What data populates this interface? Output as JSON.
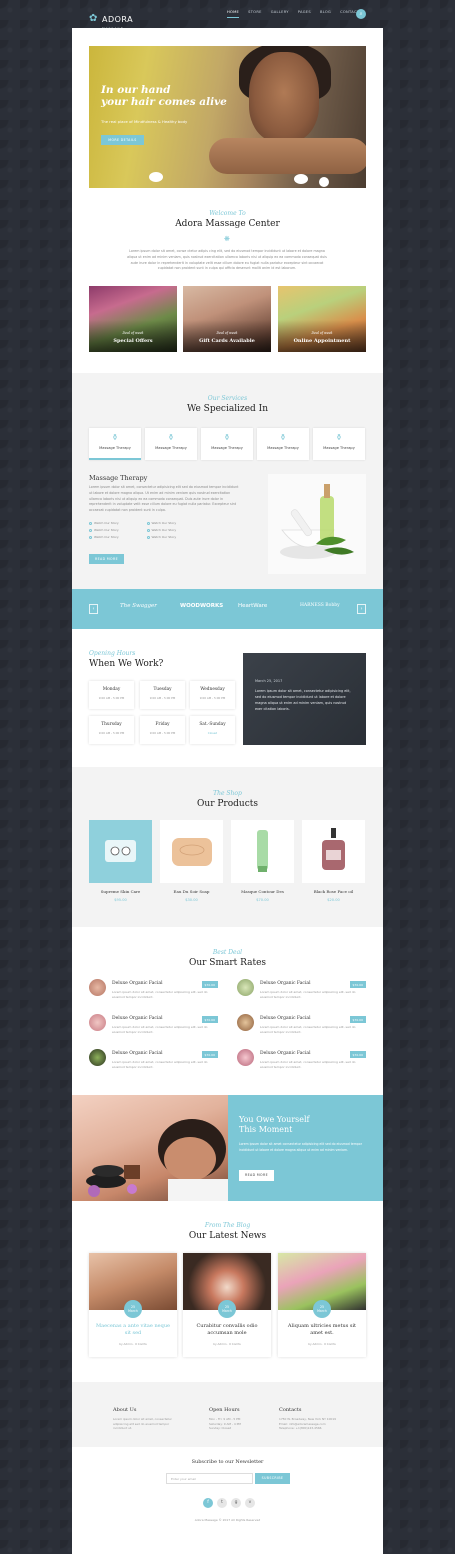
{
  "header": {
    "logo": "ADORA",
    "logo_sub": "MASSAGE",
    "nav": [
      "HOME",
      "STORE",
      "GALLERY",
      "PAGES",
      "BLOG",
      "CONTACT"
    ],
    "active_nav": "HOME"
  },
  "hero": {
    "title_line1": "In our hand",
    "title_line2": "your hair comes alive",
    "subtitle": "The real place of Mindfulness & Healthy body",
    "button": "MORE DETAILS"
  },
  "welcome": {
    "pre_title": "Welcome To",
    "title": "Adora Massage Center",
    "text": "Lorem ipsum dolor sit amet, conse ctetur adipis cing elit, sed do eiusmod tempor incididunt ut labore et dolore magna aliqua ut enim ad minim veniam, quis nostrud exercitation ullamco laboris nisi ut aliquip ex ea commodo consequat duis aute irure dolor in reprehenderit in voluptate velit esse cillum dolore eu fugiat nulla pariatur excepteur sint occaecat cupidatat non proident sunt in culpa qui officia deserunt mollit anim id est laborum."
  },
  "promos": [
    {
      "small": "Deal of week",
      "big": "Special Offers"
    },
    {
      "small": "Deal of week",
      "big": "Gift Cards Available"
    },
    {
      "small": "Deal of week",
      "big": "Online Appointment"
    }
  ],
  "services": {
    "pre_title": "Our Services",
    "title": "We Specialized In",
    "tabs": [
      "Massage Therapy",
      "Massage Therapy",
      "Massage Therapy",
      "Massage Therapy",
      "Massage Therapy"
    ],
    "detail_title": "Massage Therapy",
    "detail_text": "Lorem ipsum dolor sit amet, consectetur adipisicing elit sed do eiusmod tempor incididunt ut labore et dolore magna aliqua. Ut enim ad minim veniam quis nostrud exercitation ullamco laboris nisi ut aliquip ex ea commodo consequat. Duis aute irure dolor in reprehenderit in voluptate velit esse cillum dolore eu fugiat nulla pariatur. Excepteur sint occaecat cupidatat non proident sunt in culpa.",
    "list": [
      "Watch Our Story",
      "Watch Our Story",
      "Watch Our Story",
      "Watch Our Story",
      "Watch Our Story",
      "Watch Our Story"
    ],
    "button": "READ MORE"
  },
  "clients": [
    "The Swagger",
    "WOODWORKS",
    "HeartWare",
    "HARNESS Bobby"
  ],
  "hours": {
    "pre_title": "Opening Hours",
    "title": "When We Work?",
    "days": [
      {
        "name": "Monday",
        "hours": "9:00 AM - 5:00 PM"
      },
      {
        "name": "Tuesday",
        "hours": "9:00 AM - 5:00 PM"
      },
      {
        "name": "Wednesday",
        "hours": "9:00 AM - 5:00 PM"
      },
      {
        "name": "Thursday",
        "hours": "9:00 AM - 5:00 PM"
      },
      {
        "name": "Friday",
        "hours": "9:00 AM - 5:00 PM"
      },
      {
        "name": "Sat.-Sunday",
        "hours": "Closed"
      }
    ],
    "panel_date": "March 25, 2017",
    "panel_text": "Lorem ipsum dolor sit amet, consectetur adipisicing elit, sed do eiusmod tempor incididunt ut labore et dolore magna aliqua ut enim ad minim veniam, quis nostrud exer citation laboris."
  },
  "shop": {
    "pre_title": "The Shop",
    "title": "Our Products",
    "products": [
      {
        "name": "Supreme Skin Care",
        "price": "$95.00"
      },
      {
        "name": "Eau Du Soir Soap",
        "price": "$30.00"
      },
      {
        "name": "Masque Contour Des",
        "price": "$70.00"
      },
      {
        "name": "Black Rose Face oil",
        "price": "$20.00"
      }
    ]
  },
  "rates": {
    "pre_title": "Best Deal",
    "title": "Our Smart Rates",
    "items": [
      {
        "name": "Deluxe Organic Facial",
        "price": "$70.00",
        "text": "Lorem ipsum dolor sit amet, consectetur adipisicing elit, sed do eiusmod tempor incididunt."
      },
      {
        "name": "Deluxe Organic Facial",
        "price": "$70.00",
        "text": "Lorem ipsum dolor sit amet, consectetur adipisicing elit, sed do eiusmod tempor incididunt."
      },
      {
        "name": "Deluxe Organic Facial",
        "price": "$70.00",
        "text": "Lorem ipsum dolor sit amet, consectetur adipisicing elit, sed do eiusmod tempor incididunt."
      },
      {
        "name": "Deluxe Organic Facial",
        "price": "$70.00",
        "text": "Lorem ipsum dolor sit amet, consectetur adipisicing elit, sed do eiusmod tempor incididunt."
      },
      {
        "name": "Deluxe Organic Facial",
        "price": "$70.00",
        "text": "Lorem ipsum dolor sit amet, consectetur adipisicing elit, sed do eiusmod tempor incididunt."
      },
      {
        "name": "Deluxe Organic Facial",
        "price": "$70.00",
        "text": "Lorem ipsum dolor sit amet, consectetur adipisicing elit, sed do eiusmod tempor incididunt."
      }
    ]
  },
  "moment": {
    "title_line1": "You Owe Yourself",
    "title_line2": "This Moment",
    "text": "Lorem ipsum dolor sit amet consectetur adipisicing elit sed do eiusmod tempor incididunt ut labore et dolore magna aliqua ut enim ad minim veniam.",
    "button": "READ MORE"
  },
  "blog": {
    "pre_title": "From The Blog",
    "title": "Our Latest News",
    "posts": [
      {
        "day": "25",
        "month": "March",
        "title": "Maecenas a ante vitae neque sit sed",
        "meta": "by Admin  ·  0 Comts"
      },
      {
        "day": "25",
        "month": "March",
        "title": "Curabitur convallis odio accumsan mole",
        "meta": "by Admin  ·  0 Comts"
      },
      {
        "day": "25",
        "month": "March",
        "title": "Aliquam ultricies metus sit amet est.",
        "meta": "by Admin  ·  0 Comts"
      }
    ]
  },
  "footer": {
    "about_title": "About Us",
    "about_text": "Lorem ipsum dolor sit amet, consectetur adipisicing elit sed do eiusmod tempor incididunt ut.",
    "hours_title": "Open Hours",
    "hours_text": "Mon - Fri: 9 AM - 5 PM\nSaturday: 9 AM - 4 PM\nSunday: Closed",
    "contact_title": "Contacts",
    "contact_text": "1750 W. Broadway, New York NY 10019\nEmail: info@adoramassage.com\nTelephone: +1(800)123-4566",
    "newsletter_title": "Subscribe to our Newsletter",
    "newsletter_placeholder": "Enter your email",
    "subscribe": "SUBSCRIBE",
    "copyright": "Adora Massage © 2017 All Rights Reserved"
  },
  "colors": {
    "accent": "#7cc7d6",
    "dark": "#2b2f38"
  }
}
